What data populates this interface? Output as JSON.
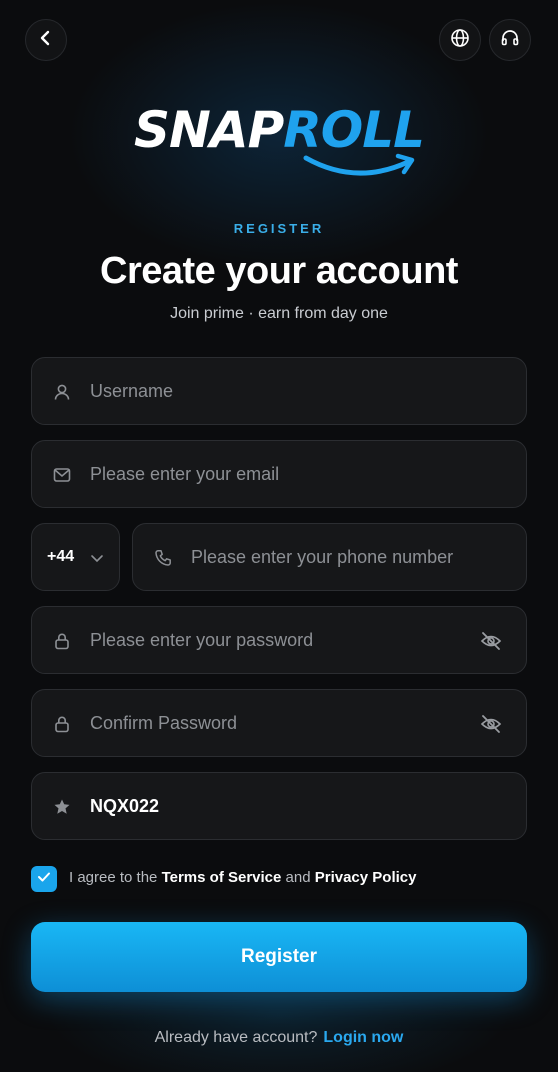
{
  "header": {
    "back_icon": "chevron-left-icon",
    "language_icon": "globe-icon",
    "support_icon": "headset-icon"
  },
  "logo": {
    "part1": "SNAP",
    "part2": "ROLL",
    "accent_color": "#1fa2ee"
  },
  "kicker": "REGISTER",
  "title": "Create your account",
  "subtitle": "Join prime · earn from day one",
  "form": {
    "username_placeholder": "Username",
    "email_placeholder": "Please enter your email",
    "country_code": "+44",
    "phone_placeholder": "Please enter your phone number",
    "password_placeholder": "Please enter your password",
    "confirm_placeholder": "Confirm Password",
    "invite_code": "NQX022"
  },
  "terms": {
    "checked": true,
    "prefix": "I agree to the",
    "terms_link": "Terms of Service",
    "and": "and",
    "privacy_link": "Privacy Policy"
  },
  "register_label": "Register",
  "footer": {
    "text": "Already have account?",
    "link": "Login now"
  }
}
